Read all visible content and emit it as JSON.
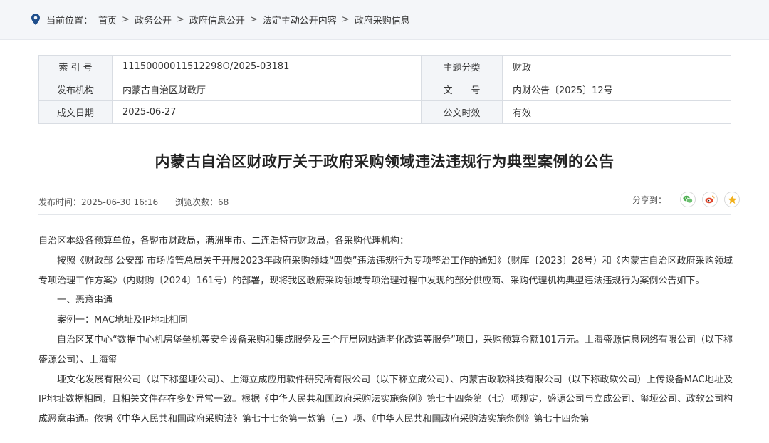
{
  "breadcrumb": {
    "prefix": "当前位置：",
    "items": [
      "首页",
      "政务公开",
      "政府信息公开",
      "法定主动公开内容",
      "政府采购信息"
    ]
  },
  "meta": {
    "index_label": "索 引 号",
    "index_value": "11150000011512298O/2025-03181",
    "subject_label": "主题分类",
    "subject_value": "财政",
    "publisher_label": "发布机构",
    "publisher_value": "内蒙古自治区财政厅",
    "docno_label": "文　　号",
    "docno_value": "内财公告〔2025〕12号",
    "date_label": "成文日期",
    "date_value": "2025-06-27",
    "validity_label": "公文时效",
    "validity_value": "有效"
  },
  "article": {
    "title": "内蒙古自治区财政厅关于政府采购领域违法违规行为典型案例的公告",
    "publish_time": "发布时间：2025-06-30 16:16",
    "views": "浏览次数：68",
    "share_label": "分享到：",
    "paragraphs": [
      "自治区本级各预算单位，各盟市财政局，满洲里市、二连浩特市财政局，各采购代理机构：",
      "按照《财政部 公安部 市场监管总局关于开展2023年政府采购领域“四类”违法违规行为专项整治工作的通知》（财库〔2023〕28号）和《内蒙古自治区政府采购领域专项治理工作方案》（内财购〔2024〕161号）的部署，现将我区政府采购领域专项治理过程中发现的部分供应商、采购代理机构典型违法违规行为案例公告如下。",
      "一、恶意串通",
      "案例一：MAC地址及IP地址相同",
      "自治区某中心“数据中心机房堡垒机等安全设备采购和集成服务及三个厅局网站适老化改造等服务”项目，采购预算金额101万元。上海盛源信息网络有限公司（以下称盛源公司）、上海玺",
      "垭文化发展有限公司（以下称玺垭公司）、上海立成应用软件研究所有限公司（以下称立成公司）、内蒙古政软科技有限公司（以下称政软公司）上传设备MAC地址及IP地址数据相同，且相关文件存在多处异常一致。根据《中华人民共和国政府采购法实施条例》第七十四条第（七）项规定，盛源公司与立成公司、玺垭公司、政软公司构成恶意串通。依据《中华人民共和国政府采购法》第七十七条第一款第（三）项、《中华人民共和国政府采购法实施条例》第七十四条第"
    ]
  },
  "colors": {
    "accent": "#1f4e8c",
    "wechat": "#4caf50",
    "weibo": "#e0462c",
    "qzone": "#f2b11b"
  }
}
